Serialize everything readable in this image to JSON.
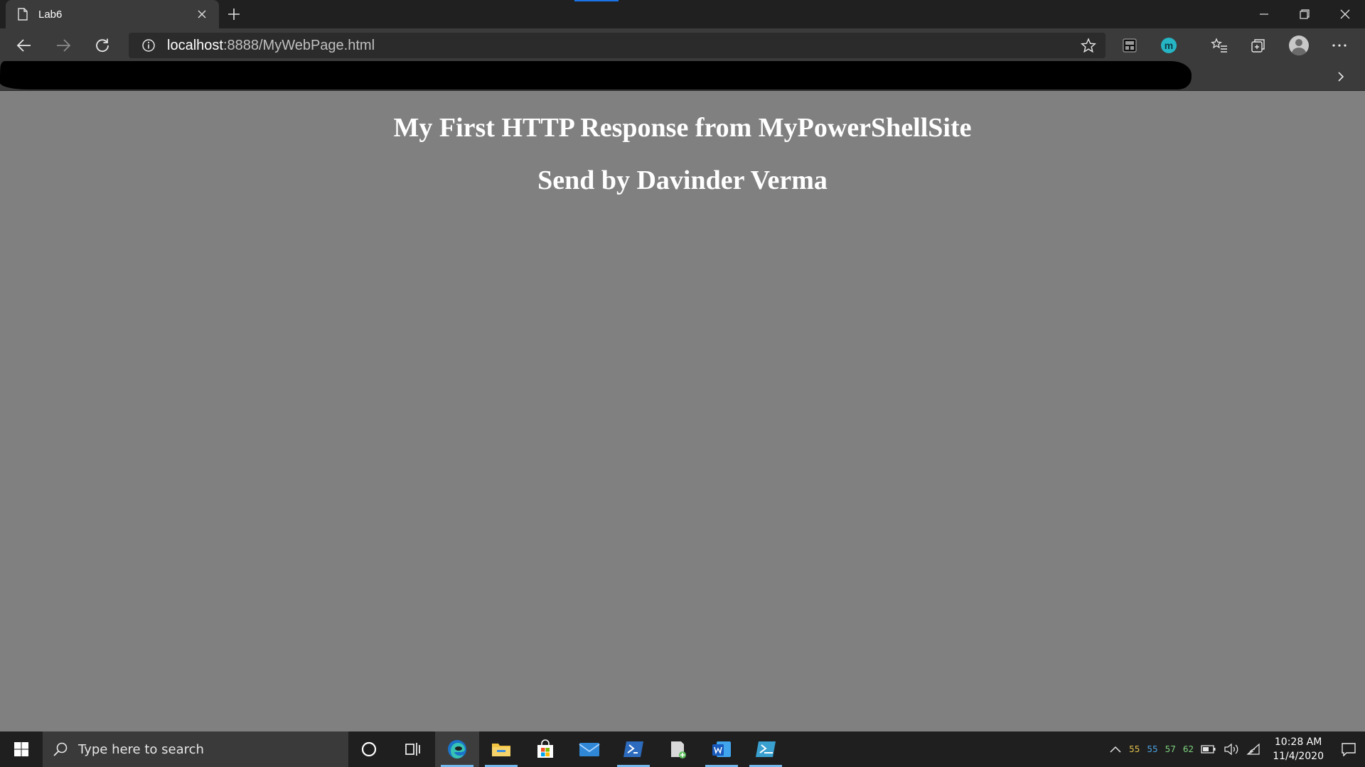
{
  "browser": {
    "tab": {
      "title": "Lab6"
    },
    "address": {
      "host": "localhost",
      "rest": ":8888/MyWebPage.html"
    }
  },
  "page": {
    "heading": "My First HTTP Response from MyPowerShellSite",
    "subheading": "Send by Davinder Verma"
  },
  "taskbar": {
    "search_placeholder": "Type here to search",
    "tray": {
      "temps": [
        {
          "value": "55",
          "color": "#e3c14a"
        },
        {
          "value": "55",
          "color": "#4aa3e3"
        },
        {
          "value": "57",
          "color": "#7ed37e"
        },
        {
          "value": "62",
          "color": "#7ed37e"
        }
      ],
      "time": "10:28 AM",
      "date": "11/4/2020"
    }
  },
  "colors": {
    "page_background": "#808080",
    "chrome_dark": "#202020",
    "chrome_toolbar": "#3b3b3b",
    "taskbar": "#1f1f1f",
    "accent": "#76b9ed"
  },
  "icons": {
    "tab": "page-icon",
    "close_tab": "close-icon",
    "new_tab": "plus-icon",
    "back": "back-arrow-icon",
    "forward": "forward-arrow-icon",
    "refresh": "refresh-icon",
    "site_info": "info-icon",
    "favorite": "star-icon",
    "extensions": [
      "bookmark-extension-icon",
      "m-extension-icon"
    ],
    "favorites_hub": "favorites-list-icon",
    "collections": "collections-icon",
    "profile": "avatar",
    "menu": "ellipsis-icon",
    "taskbar_apps": [
      "cortana-icon",
      "task-view-icon",
      "edge-icon",
      "file-explorer-icon",
      "store-icon",
      "mail-icon",
      "powershell-icon",
      "app-icon",
      "word-icon",
      "powershell-ise-icon"
    ]
  }
}
